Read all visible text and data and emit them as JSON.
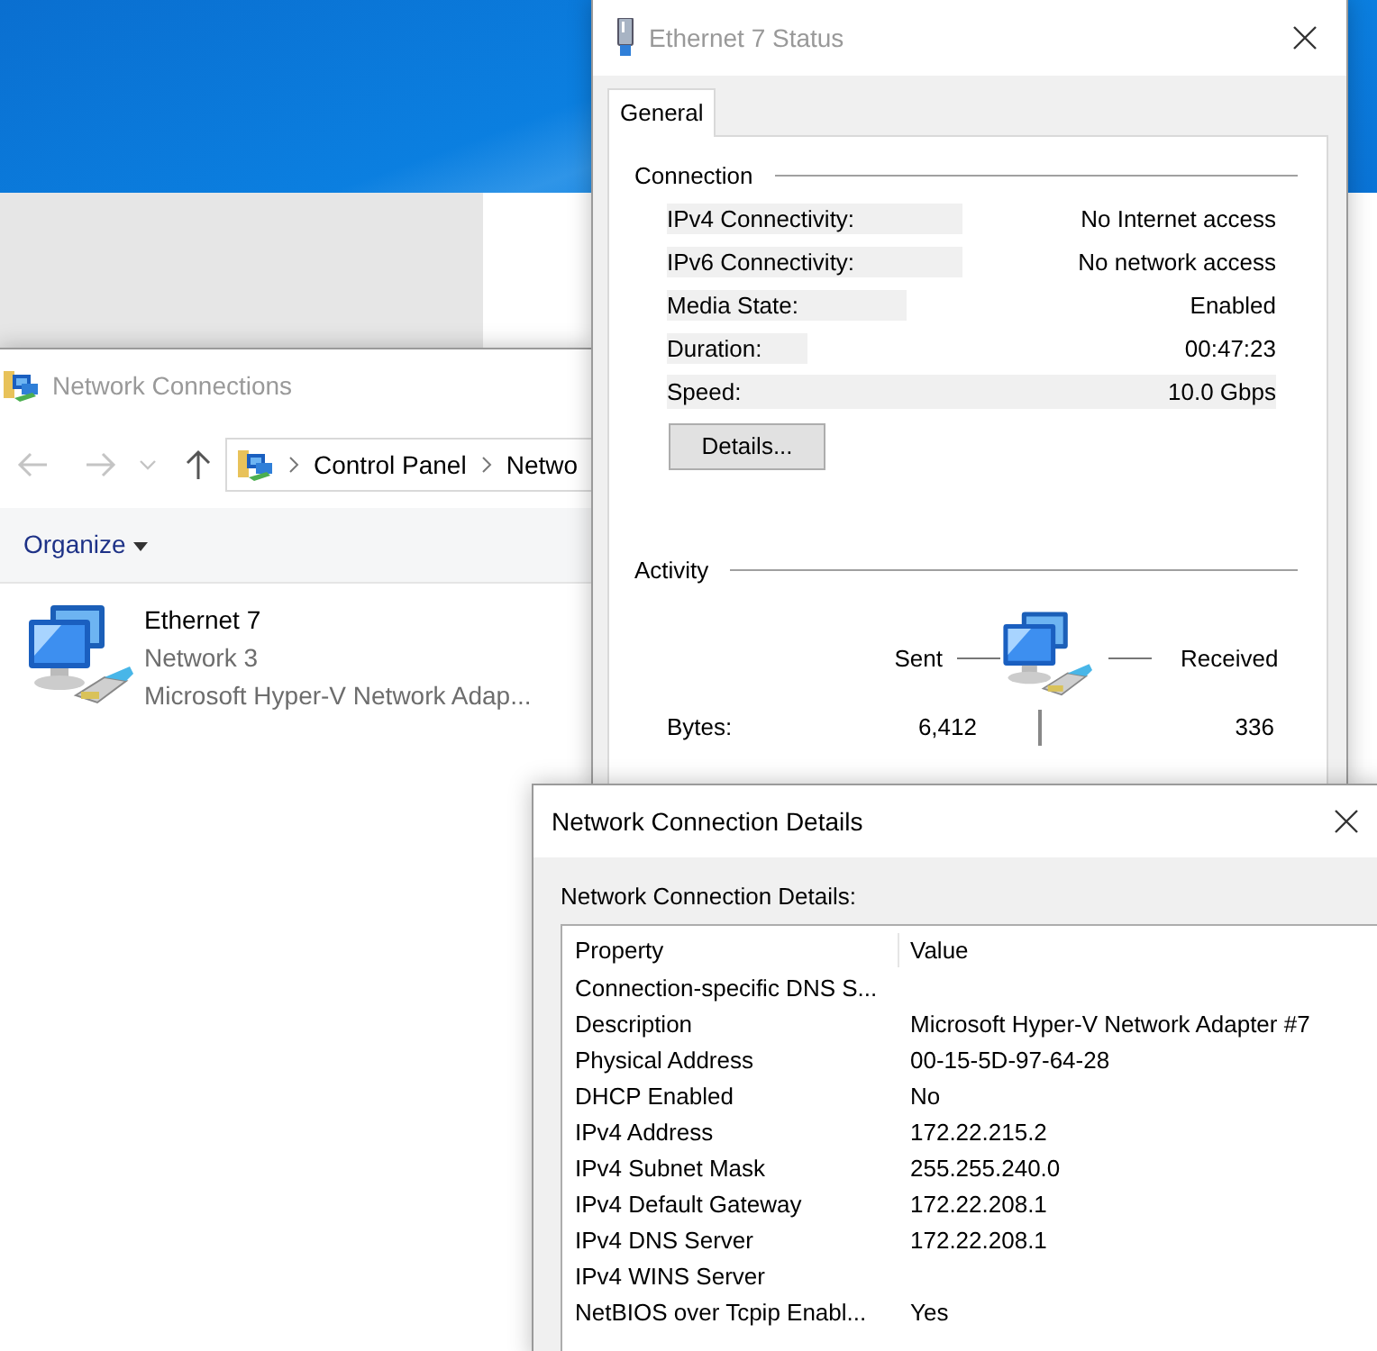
{
  "network_connections": {
    "title": "Network Connections",
    "breadcrumb": [
      "Control Panel",
      "Netwo"
    ],
    "organize": "Organize",
    "items": [
      {
        "name": "Ethernet 7",
        "network": "Network 3",
        "adapter": "Microsoft Hyper-V Network Adap..."
      }
    ]
  },
  "status_window": {
    "title": "Ethernet 7 Status",
    "tabs": [
      {
        "label": "General",
        "selected": true
      }
    ],
    "connection": {
      "heading": "Connection",
      "rows": [
        {
          "label": "IPv4 Connectivity:",
          "value": "No Internet access"
        },
        {
          "label": "IPv6 Connectivity:",
          "value": "No network access"
        },
        {
          "label": "Media State:",
          "value": "Enabled"
        },
        {
          "label": "Duration:",
          "value": "00:47:23"
        },
        {
          "label": "Speed:",
          "value": "10.0 Gbps"
        }
      ]
    },
    "details_button": "Details...",
    "activity": {
      "heading": "Activity",
      "sent_label": "Sent",
      "received_label": "Received",
      "rows": [
        {
          "label": "Bytes:",
          "sent": "6,412",
          "received": "336"
        }
      ]
    }
  },
  "details_window": {
    "title": "Network Connection Details",
    "caption": "Network Connection Details:",
    "columns": [
      "Property",
      "Value"
    ],
    "rows": [
      {
        "property": "Connection-specific DNS S..."
      },
      {
        "property": "Description",
        "value": "Microsoft Hyper-V Network Adapter #7"
      },
      {
        "property": "Physical Address",
        "value": "00-15-5D-97-64-28"
      },
      {
        "property": "DHCP Enabled",
        "value": "No"
      },
      {
        "property": "IPv4 Address",
        "value": "172.22.215.2"
      },
      {
        "property": "IPv4 Subnet Mask",
        "value": "255.255.240.0"
      },
      {
        "property": "IPv4 Default Gateway",
        "value": "172.22.208.1"
      },
      {
        "property": "IPv4 DNS Server",
        "value": "172.22.208.1"
      },
      {
        "property": "IPv4 WINS Server"
      },
      {
        "property": "NetBIOS over Tcpip Enabl...",
        "value": "Yes"
      }
    ]
  }
}
